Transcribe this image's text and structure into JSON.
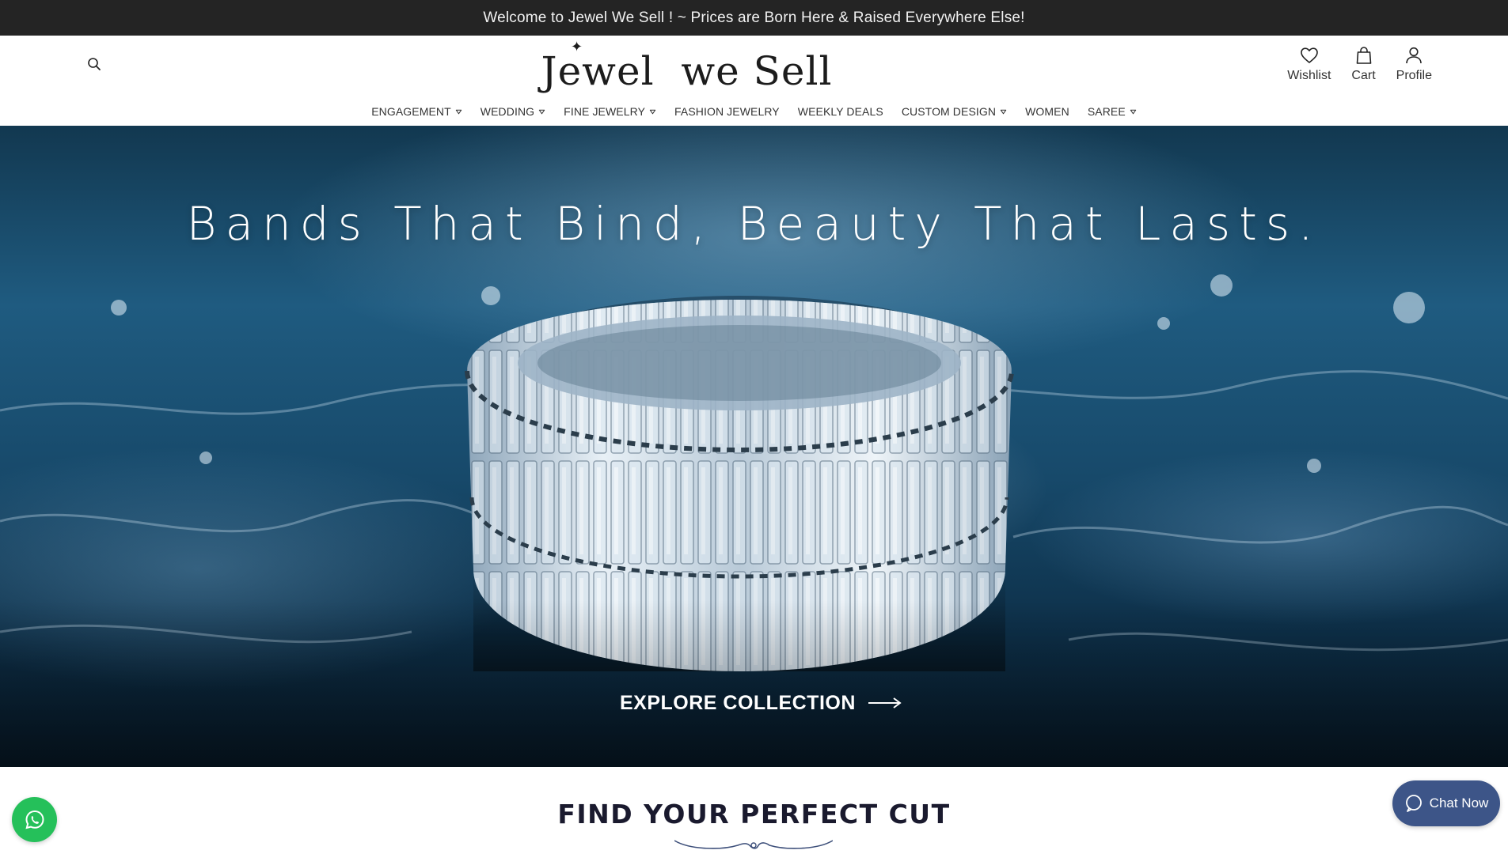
{
  "announcement": {
    "text": "Welcome to Jewel We Sell ! ~ Prices are Born Here & Raised Everywhere Else!"
  },
  "header": {
    "logo_text": "Jewel  we Sell",
    "search_icon": "search-icon",
    "actions": [
      {
        "label": "Wishlist",
        "icon": "heart-icon"
      },
      {
        "label": "Cart",
        "icon": "shopping-bag-icon"
      },
      {
        "label": "Profile",
        "icon": "user-icon"
      }
    ]
  },
  "nav": {
    "items": [
      {
        "label": "ENGAGEMENT",
        "has_dropdown": true
      },
      {
        "label": "WEDDING",
        "has_dropdown": true
      },
      {
        "label": "FINE JEWELRY",
        "has_dropdown": true
      },
      {
        "label": "FASHION JEWELRY",
        "has_dropdown": false
      },
      {
        "label": "WEEKLY DEALS",
        "has_dropdown": false
      },
      {
        "label": "CUSTOM DESIGN",
        "has_dropdown": true
      },
      {
        "label": "WOMEN",
        "has_dropdown": false
      },
      {
        "label": "SAREE",
        "has_dropdown": true
      }
    ]
  },
  "hero": {
    "title": "Bands That Bind, Beauty That Lasts.",
    "cta_label": "EXPLORE COLLECTION"
  },
  "section": {
    "title": "FIND YOUR PERFECT CUT"
  },
  "floating": {
    "whatsapp_icon": "whatsapp-icon",
    "chat_label": "Chat Now",
    "chat_icon": "chat-bubble-icon"
  },
  "colors": {
    "announcement_bg": "#242424",
    "chat_button_bg": "#3d5588",
    "whatsapp_bg": "#25c05a",
    "hero_water": "#1f5b80"
  }
}
